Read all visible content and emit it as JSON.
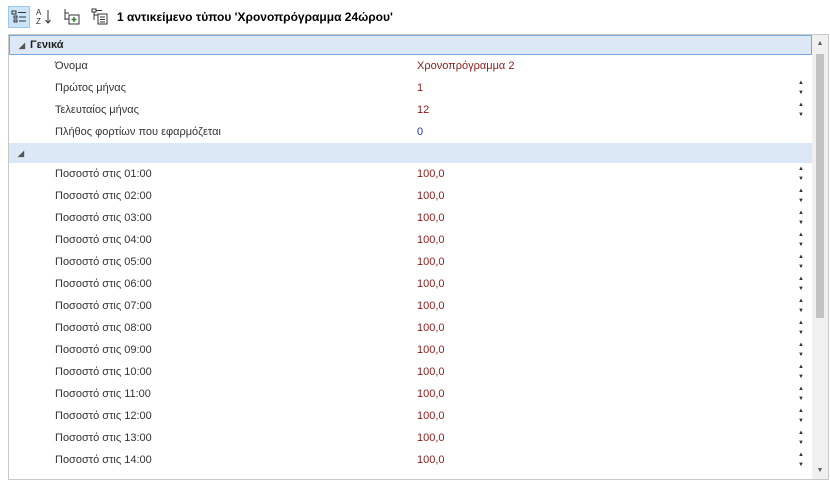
{
  "toolbar": {
    "buttons": [
      {
        "name": "categorized-view-button",
        "icon": "categorized-icon",
        "active": true
      },
      {
        "name": "alphabetical-sort-button",
        "icon": "sort-az-icon",
        "active": false
      },
      {
        "name": "add-object-button",
        "icon": "add-object-icon",
        "active": false
      },
      {
        "name": "hierarchy-button",
        "icon": "hierarchy-icon",
        "active": false
      }
    ],
    "title": "1 αντικείμενο τύπου 'Χρονοπρόγραμμα 24ώρου'"
  },
  "sections": [
    {
      "title": "Γενικά",
      "rows": [
        {
          "label": "Όνομα",
          "value": "Χρονοπρόγραμμα 2",
          "color": "red",
          "spinner": false
        },
        {
          "label": "Πρώτος μήνας",
          "value": "1",
          "color": "red",
          "spinner": true
        },
        {
          "label": "Τελευταίος μήνας",
          "value": "12",
          "color": "red",
          "spinner": true
        },
        {
          "label": "Πλήθος φορτίων που εφαρμόζεται",
          "value": "0",
          "color": "blue",
          "spinner": false
        }
      ]
    },
    {
      "title": "",
      "rows": [
        {
          "label": "Ποσοστό στις 01:00",
          "value": "100,0",
          "color": "red",
          "spinner": true
        },
        {
          "label": "Ποσοστό στις 02:00",
          "value": "100,0",
          "color": "red",
          "spinner": true
        },
        {
          "label": "Ποσοστό στις 03:00",
          "value": "100,0",
          "color": "red",
          "spinner": true
        },
        {
          "label": "Ποσοστό στις 04:00",
          "value": "100,0",
          "color": "red",
          "spinner": true
        },
        {
          "label": "Ποσοστό στις 05:00",
          "value": "100,0",
          "color": "red",
          "spinner": true
        },
        {
          "label": "Ποσοστό στις 06:00",
          "value": "100,0",
          "color": "red",
          "spinner": true
        },
        {
          "label": "Ποσοστό στις 07:00",
          "value": "100,0",
          "color": "red",
          "spinner": true
        },
        {
          "label": "Ποσοστό στις 08:00",
          "value": "100,0",
          "color": "red",
          "spinner": true
        },
        {
          "label": "Ποσοστό στις 09:00",
          "value": "100,0",
          "color": "red",
          "spinner": true
        },
        {
          "label": "Ποσοστό στις 10:00",
          "value": "100,0",
          "color": "red",
          "spinner": true
        },
        {
          "label": "Ποσοστό στις 11:00",
          "value": "100,0",
          "color": "red",
          "spinner": true
        },
        {
          "label": "Ποσοστό στις 12:00",
          "value": "100,0",
          "color": "red",
          "spinner": true
        },
        {
          "label": "Ποσοστό στις 13:00",
          "value": "100,0",
          "color": "red",
          "spinner": true
        },
        {
          "label": "Ποσοστό στις 14:00",
          "value": "100,0",
          "color": "red",
          "spinner": true
        }
      ]
    }
  ],
  "colors": {
    "value_red": "#8b1a1a",
    "value_blue": "#1f3a93",
    "category_bg": "#dde8f6",
    "selection_border": "#7aa7d9"
  }
}
